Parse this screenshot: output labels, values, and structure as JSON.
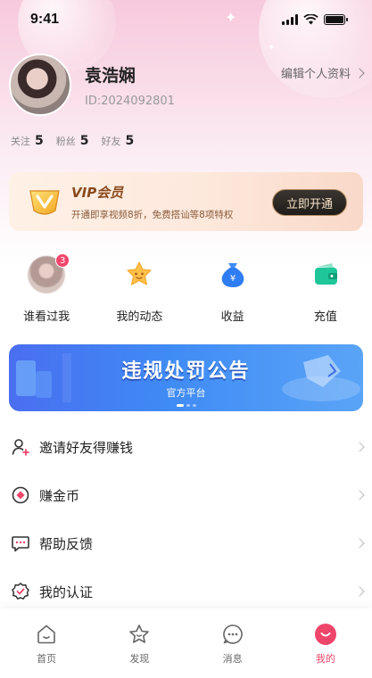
{
  "status_bar": {
    "time": "9:41"
  },
  "profile": {
    "username": "袁浩娴",
    "user_id": "ID:2024092801",
    "edit_label": "编辑个人资料"
  },
  "stats": [
    {
      "label": "关注",
      "value": "5"
    },
    {
      "label": "粉丝",
      "value": "5"
    },
    {
      "label": "好友",
      "value": "5"
    }
  ],
  "vip": {
    "title": "VIP会员",
    "description": "开通即享视频8折，免费搭讪等8项特权",
    "button_label": "立即开通",
    "accent": "#8a4a1c"
  },
  "quick_actions": [
    {
      "label": "谁看过我",
      "icon": "visitor-avatar",
      "badge": "3"
    },
    {
      "label": "我的动态",
      "icon": "star-face-icon"
    },
    {
      "label": "收益",
      "icon": "money-bag-icon"
    },
    {
      "label": "充值",
      "icon": "wallet-icon"
    }
  ],
  "banner": {
    "title": "违规处罚公告",
    "subtitle": "官方平台",
    "slide_index": 1,
    "slide_count": 3
  },
  "menu": [
    {
      "label": "邀请好友得赚钱",
      "icon": "invite-user-icon"
    },
    {
      "label": "赚金币",
      "icon": "coin-icon"
    },
    {
      "label": "帮助反馈",
      "icon": "chat-feedback-icon"
    },
    {
      "label": "我的认证",
      "icon": "verified-badge-icon"
    }
  ],
  "tabs": [
    {
      "label": "首页",
      "icon": "home-icon",
      "active": false
    },
    {
      "label": "发现",
      "icon": "discover-icon",
      "active": false
    },
    {
      "label": "消息",
      "icon": "message-icon",
      "active": false
    },
    {
      "label": "我的",
      "icon": "profile-icon",
      "active": true
    }
  ],
  "colors": {
    "brand": "#f0456b",
    "banner": "#3f8bf5",
    "vip_button": "#1f1c19"
  }
}
